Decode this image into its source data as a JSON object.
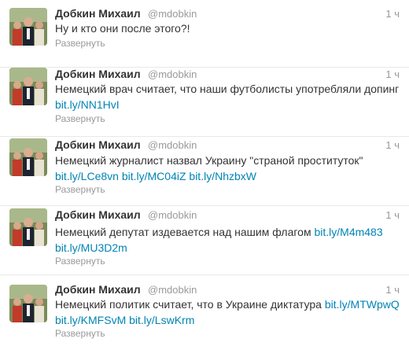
{
  "tweets": [
    {
      "name": "Добкин Михаил",
      "handle": "@mdobkin",
      "time": "1 ч",
      "text": "Ну и кто они после этого?!",
      "links": [],
      "expand": "Развернуть"
    },
    {
      "name": "Добкин Михаил",
      "handle": "@mdobkin",
      "time": "1 ч",
      "text": "Немецкий врач считает, что наши футболисты употребляли допинг",
      "links": [
        "bit.ly/NN1HvI"
      ],
      "expand": "Развернуть"
    },
    {
      "name": "Добкин Михаил",
      "handle": "@mdobkin",
      "time": "1 ч",
      "text": "Немецкий журналист назвал Украину \"страной проституток\"",
      "links": [
        "bit.ly/LCe8vn",
        "bit.ly/MC04iZ",
        "bit.ly/NhzbxW"
      ],
      "expand": "Развернуть"
    },
    {
      "name": "Добкин Михаил",
      "handle": "@mdobkin",
      "time": "1 ч",
      "text": "Немецкий депутат издевается над нашим флагом",
      "links": [
        "bit.ly/M4m483",
        "bit.ly/MU3D2m"
      ],
      "expand": "Развернуть"
    },
    {
      "name": "Добкин Михаил",
      "handle": "@mdobkin",
      "time": "1 ч",
      "text": "Немецкий политик считает, что в Украине диктатура",
      "links": [
        "bit.ly/MTWpwQ",
        "bit.ly/KMFSvM",
        "bit.ly/LswKrm"
      ],
      "expand": "Развернуть"
    }
  ],
  "colors": {
    "name": "#333333",
    "meta": "#999999",
    "link": "#0084b4",
    "divider": "#e8e8e8"
  }
}
